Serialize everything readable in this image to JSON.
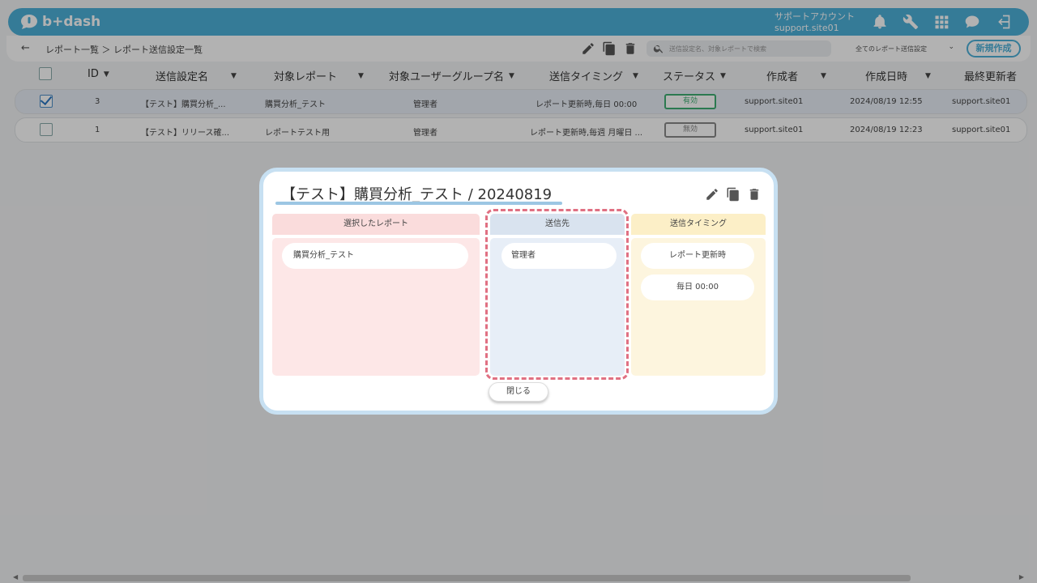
{
  "header": {
    "logo_text": "b+dash",
    "account_line1": "サポートアカウント",
    "account_line2": "support.site01"
  },
  "nav": {
    "back_label": "←",
    "breadcrumb": "レポート一覧 ＞ レポート送信設定一覧"
  },
  "search": {
    "placeholder": "送信設定名、対象レポートで検索"
  },
  "filter": {
    "selected": "全てのレポート送信設定",
    "chevron": "⌄"
  },
  "new_button": "新規作成",
  "table": {
    "columns": [
      "ID",
      "送信設定名",
      "対象レポート",
      "対象ユーザーグループ名",
      "送信タイミング",
      "ステータス",
      "作成者",
      "作成日時",
      "最終更新者"
    ],
    "rows": [
      {
        "id": "3",
        "name": "【テスト】購買分析_...",
        "report": "購買分析_テスト",
        "group": "管理者",
        "timing": "レポート更新時,毎日 00:00",
        "status": "有効",
        "creator": "support.site01",
        "created": "2024/08/19 12:55",
        "updater": "support.site01"
      },
      {
        "id": "1",
        "name": "【テスト】リリース確...",
        "report": "レポートテスト用",
        "group": "管理者",
        "timing": "レポート更新時,毎週 月曜日 ...",
        "status": "無効",
        "creator": "support.site01",
        "created": "2024/08/19 12:23",
        "updater": "support.site01"
      }
    ]
  },
  "modal": {
    "title": "【テスト】購買分析_テスト / 20240819",
    "col_report": {
      "header": "選択したレポート",
      "items": [
        "購買分析_テスト"
      ]
    },
    "col_recipient": {
      "header": "送信先",
      "items": [
        "管理者"
      ]
    },
    "col_timing": {
      "header": "送信タイミング",
      "items": [
        "レポート更新時",
        "毎日 00:00"
      ]
    },
    "close_label": "閉じる"
  }
}
